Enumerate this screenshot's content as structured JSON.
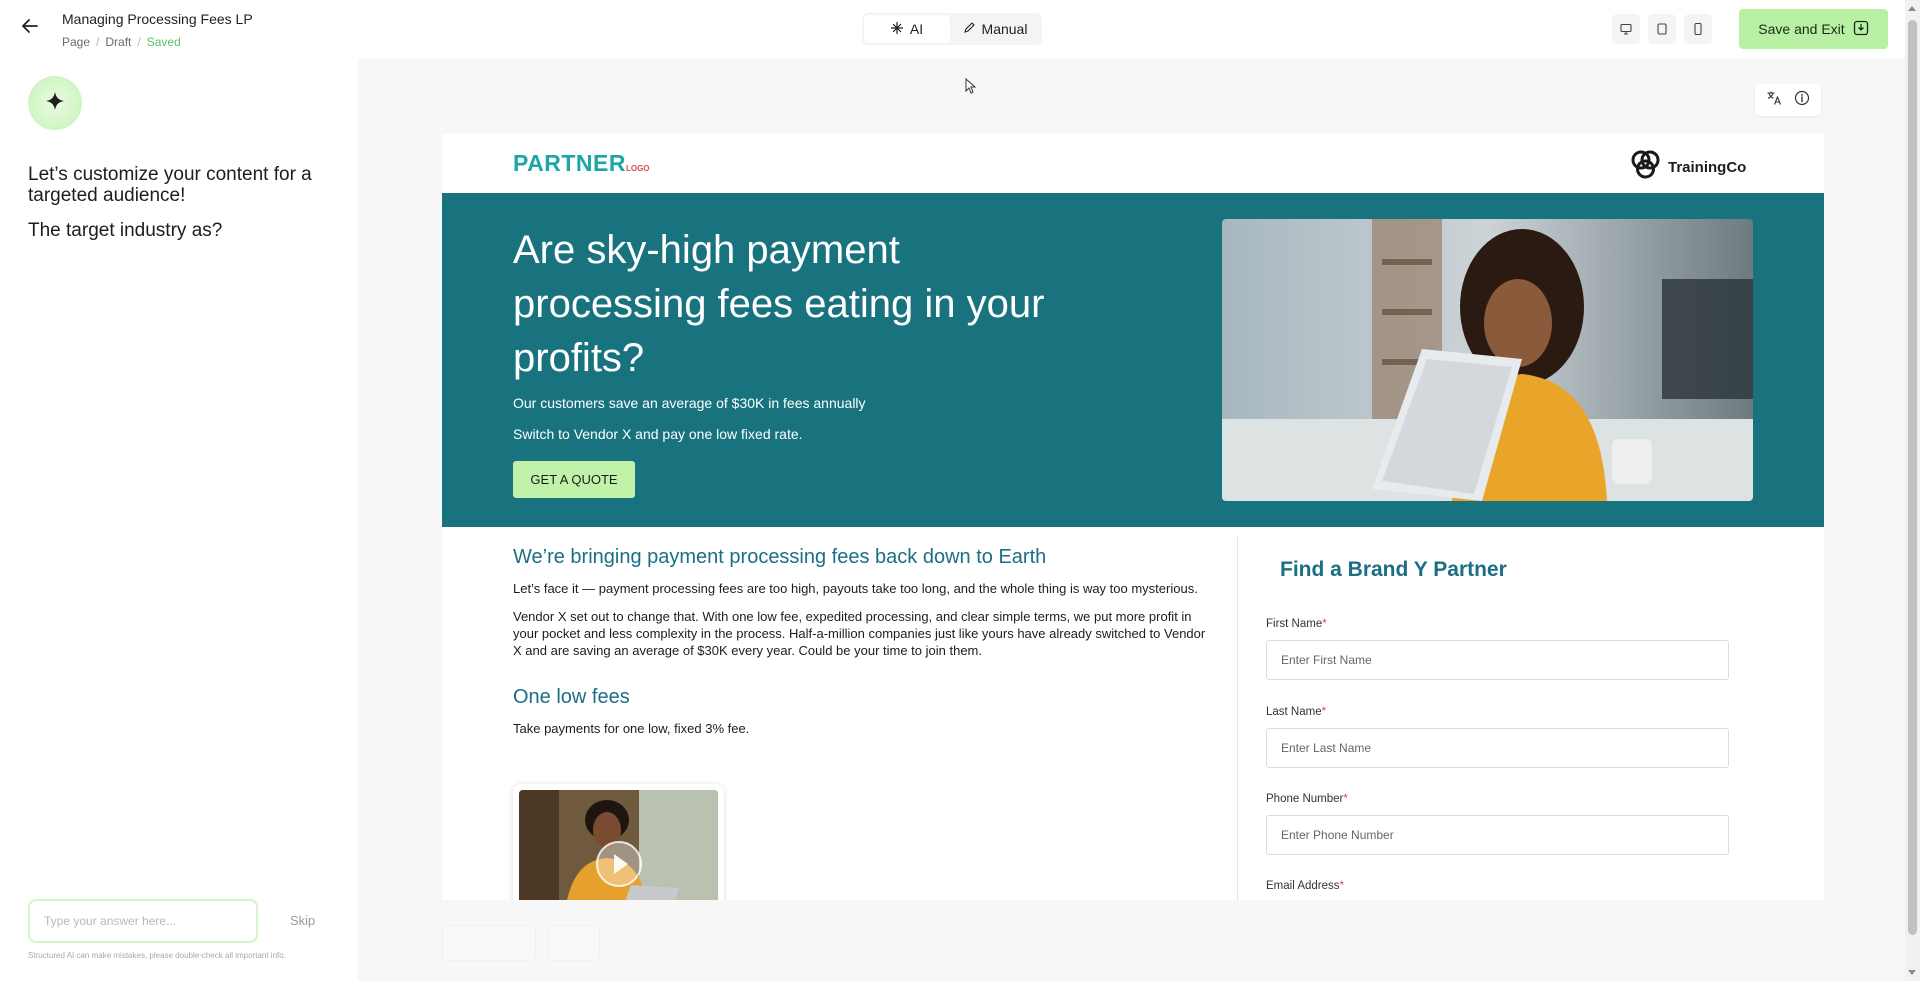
{
  "header": {
    "page_title": "Managing Processing Fees LP",
    "breadcrumb": [
      "Page",
      "Draft",
      "Saved"
    ],
    "modes": {
      "ai_label": "AI",
      "manual_label": "Manual"
    },
    "save_exit_label": "Save and Exit",
    "accent_color": "#b8f0a4"
  },
  "left_panel": {
    "prompt_heading": "Let’s customize your content for a targeted audience!",
    "prompt_question": "The target industry as?",
    "answer_placeholder": "Type your answer here...",
    "skip_label": "Skip",
    "disclaimer": "Structured AI can make mistakes, please double-check all important info."
  },
  "landing_page": {
    "partner_logo": {
      "main": "PARTNER",
      "suffix": "LOGO"
    },
    "brand_logo": "TrainingCo",
    "hero": {
      "heading": "Are sky-high payment processing fees eating in your profits?",
      "subline1": "Our customers save an average of $30K in fees annually",
      "subline2": "Switch to Vendor X and pay one low fixed rate.",
      "cta_label": "GET A QUOTE",
      "background_color": "#18737f"
    },
    "section1": {
      "heading": "We’re bringing payment processing fees back down to Earth",
      "para1": "Let’s face it — payment processing fees are too high, payouts take too long, and the whole thing is way too mysterious.",
      "para2": "Vendor X set out to change that. With one low fee, expedited processing, and clear simple terms, we put more profit in your pocket and less complexity in the process. Half-a-million companies just like yours have already switched to Vendor X and are saving an average of $30K every year. Could be your time to join them."
    },
    "section2": {
      "heading": "One low fees",
      "para": "Take payments for one low, fixed 3% fee."
    },
    "form": {
      "title": "Find a Brand Y Partner",
      "fields": [
        {
          "label": "First Name",
          "placeholder": "Enter First Name"
        },
        {
          "label": "Last Name",
          "placeholder": "Enter Last Name"
        },
        {
          "label": "Phone Number",
          "placeholder": "Enter Phone Number"
        },
        {
          "label": "Email Address"
        }
      ],
      "required_mark": "*"
    }
  },
  "icons": [
    "arrow-left-icon",
    "sparkle-icon",
    "pencil-icon",
    "desktop-icon",
    "tablet-icon",
    "mobile-icon",
    "save-exit-icon",
    "translate-icon",
    "info-icon",
    "play-icon"
  ]
}
